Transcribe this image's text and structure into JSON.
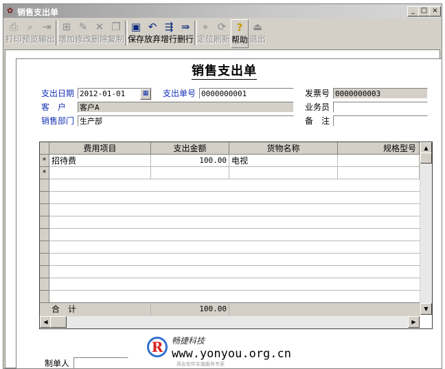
{
  "window": {
    "title": "销售支出单",
    "app_icon": "app-icon",
    "controls": [
      "_",
      "□",
      "×"
    ]
  },
  "toolbar": [
    {
      "label": "打印",
      "icon": "print-icon",
      "enabled": false
    },
    {
      "label": "预览",
      "icon": "preview-icon",
      "enabled": false
    },
    {
      "label": "输出",
      "icon": "export-icon",
      "enabled": false
    },
    {
      "label": "增加",
      "icon": "add-icon",
      "enabled": false
    },
    {
      "label": "修改",
      "icon": "edit-icon",
      "enabled": false
    },
    {
      "label": "删除",
      "icon": "delete-icon",
      "enabled": false
    },
    {
      "label": "复制",
      "icon": "copy-icon",
      "enabled": false
    },
    {
      "label": "保存",
      "icon": "save-icon",
      "enabled": true
    },
    {
      "label": "放弃",
      "icon": "undo-icon",
      "enabled": true
    },
    {
      "label": "增行",
      "icon": "insert-row-icon",
      "enabled": true
    },
    {
      "label": "删行",
      "icon": "delete-row-icon",
      "enabled": true
    },
    {
      "label": "定位",
      "icon": "locate-icon",
      "enabled": false
    },
    {
      "label": "刷新",
      "icon": "refresh-icon",
      "enabled": false
    },
    {
      "label": "帮助",
      "icon": "help-icon",
      "enabled": true
    },
    {
      "label": "退出",
      "icon": "exit-icon",
      "enabled": false
    }
  ],
  "document": {
    "title": "销售支出单",
    "date_label": "支出日期",
    "date_value": "2012-01-01",
    "number_label": "支出单号",
    "number_value": "0000000001",
    "invoice_label": "发票号",
    "invoice_value": "0000000003",
    "customer_label": "客　户",
    "customer_value": "客户A",
    "salesman_label": "业务员",
    "salesman_value": "",
    "dept_label": "销售部门",
    "dept_value": "生产部",
    "remark_label": "备　注",
    "remark_value": ""
  },
  "grid": {
    "columns": [
      "费用项目",
      "支出金额",
      "货物名称",
      "规格型号"
    ],
    "rows": [
      {
        "marker": "*",
        "item": "招待费",
        "amount": "100.00",
        "goods": "电视",
        "spec": ""
      },
      {
        "marker": "*",
        "item": "",
        "amount": "",
        "goods": "",
        "spec": ""
      }
    ],
    "total_label": "合　计",
    "total_amount": "100.00"
  },
  "footer": {
    "maker_label": "制单人"
  },
  "watermark": {
    "logo_text": "R",
    "name": "畅捷科技",
    "url": "www.yonyou.org.cn",
    "subtitle": "用友软件实施服务专家"
  },
  "colors": {
    "label_blue": "#1432b4",
    "readonly_bg": "#d4d0c8"
  }
}
